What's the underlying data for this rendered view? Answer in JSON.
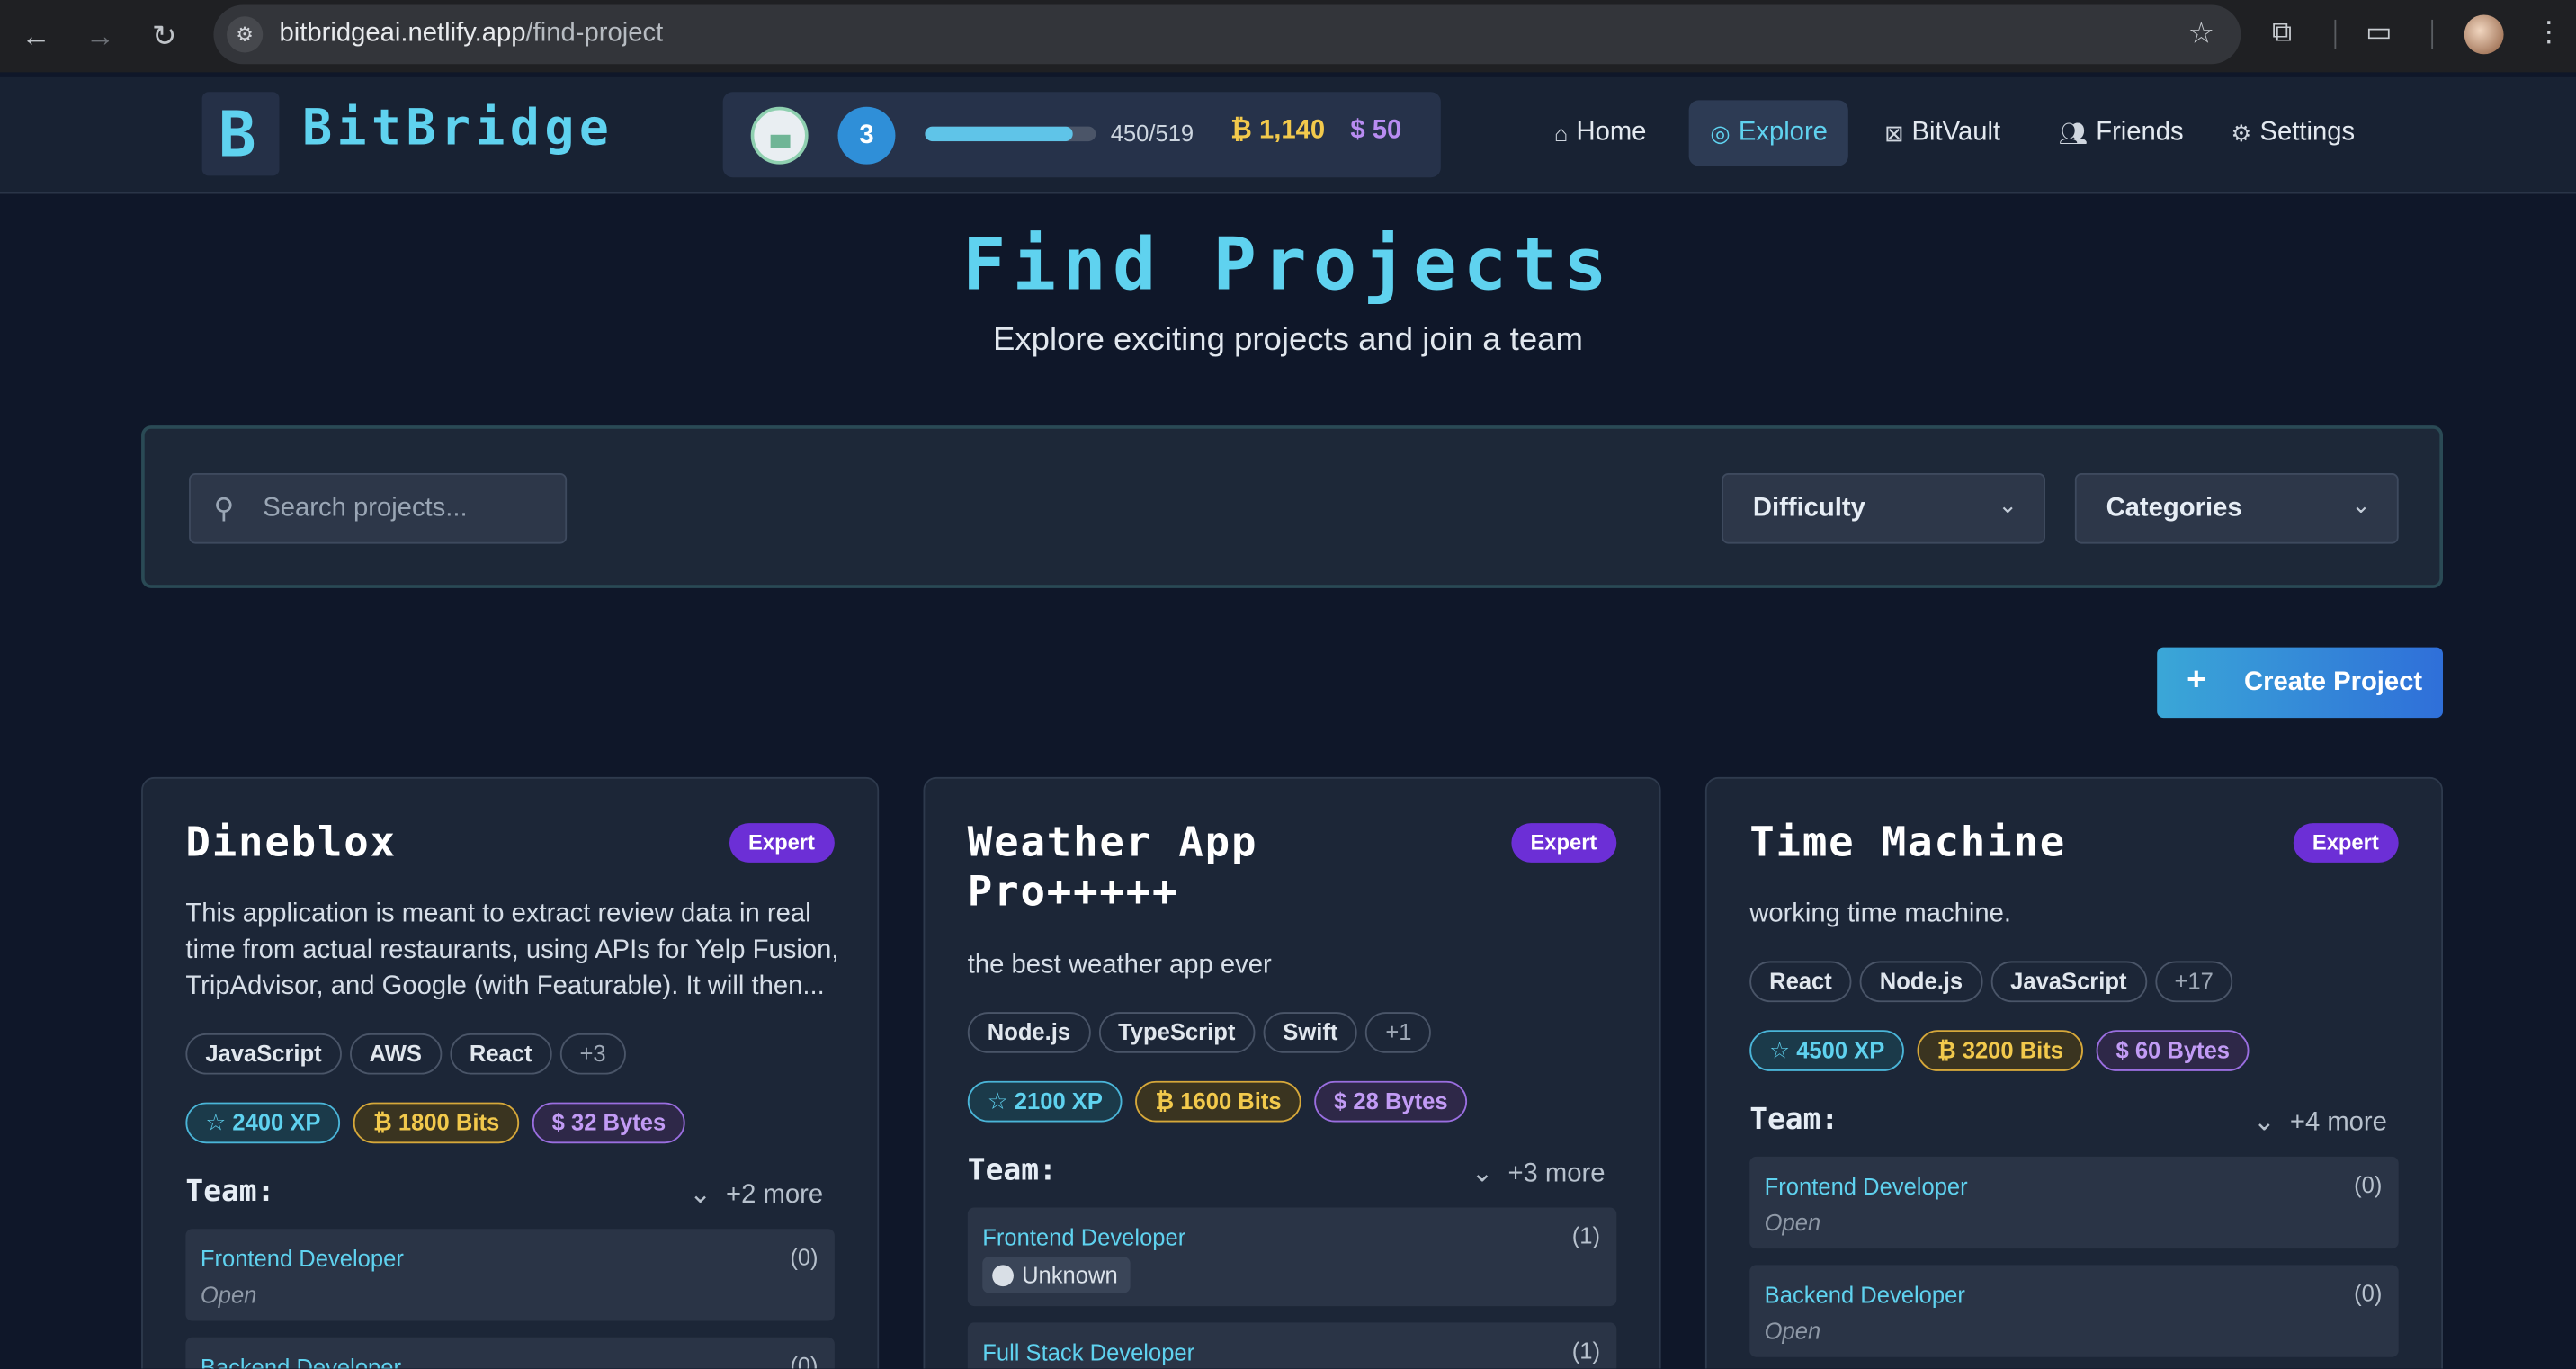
{
  "browser": {
    "url_host": "bitbridgeai.netlify.app",
    "url_path": "/find-project"
  },
  "header": {
    "logo_text": "BitBridge",
    "level": "3",
    "xp_text": "450/519",
    "xp_progress": 0.867,
    "bits": "1,140",
    "bytes": "50",
    "nav": [
      {
        "label": "Home",
        "icon": "home-icon",
        "active": false
      },
      {
        "label": "Explore",
        "icon": "compass-icon",
        "active": true
      },
      {
        "label": "BitVault",
        "icon": "vault-icon",
        "active": false
      },
      {
        "label": "Friends",
        "icon": "users-icon",
        "active": false
      },
      {
        "label": "Settings",
        "icon": "gear-icon",
        "active": false
      }
    ]
  },
  "page": {
    "title": "Find Projects",
    "subtitle": "Explore exciting projects and join a team"
  },
  "filters": {
    "search_placeholder": "Search projects...",
    "difficulty": "Difficulty",
    "categories": "Categories"
  },
  "create_label": "Create Project",
  "cards": [
    {
      "title": "Dineblox",
      "badge": "Expert",
      "description": "This application is meant to extract review data in real time from actual restaurants, using APIs for Yelp Fusion, TripAdvisor, and Google (with Featurable). It will then...",
      "tags": [
        "JavaScript",
        "AWS",
        "React",
        "+3"
      ],
      "xp": "2400 XP",
      "bits": "1800 Bits",
      "bytes": "32 Bytes",
      "team_label": "Team:",
      "more": "+2 more",
      "roles": [
        {
          "name": "Frontend Developer",
          "count": "(0)",
          "status": "Open"
        },
        {
          "name": "Backend Developer",
          "count": "(0)",
          "status": ""
        }
      ]
    },
    {
      "title": "Weather App Pro+++++",
      "badge": "Expert",
      "description": "the best weather app ever",
      "tags": [
        "Node.js",
        "TypeScript",
        "Swift",
        "+1"
      ],
      "xp": "2100 XP",
      "bits": "1600 Bits",
      "bytes": "28 Bytes",
      "team_label": "Team:",
      "more": "+3 more",
      "roles": [
        {
          "name": "Frontend Developer",
          "count": "(1)",
          "member": "Unknown"
        },
        {
          "name": "Full Stack Developer",
          "count": "(1)",
          "status": ""
        }
      ]
    },
    {
      "title": "Time Machine",
      "badge": "Expert",
      "description": "working time machine.",
      "tags": [
        "React",
        "Node.js",
        "JavaScript",
        "+17"
      ],
      "xp": "4500 XP",
      "bits": "3200 Bits",
      "bytes": "60 Bytes",
      "team_label": "Team:",
      "more": "+4 more",
      "roles": [
        {
          "name": "Frontend Developer",
          "count": "(0)",
          "status": "Open"
        },
        {
          "name": "Backend Developer",
          "count": "(0)",
          "status": "Open"
        }
      ]
    }
  ]
}
